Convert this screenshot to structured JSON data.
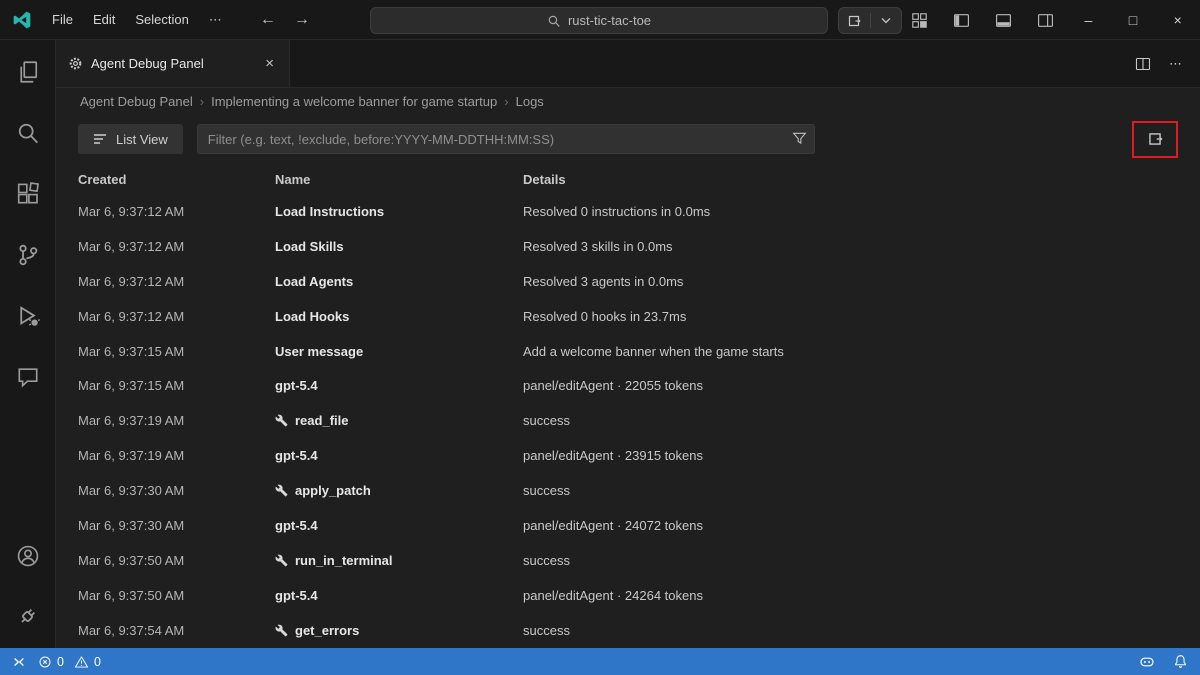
{
  "titlebar": {
    "menus": [
      "File",
      "Edit",
      "Selection"
    ],
    "search_value": "rust-tic-tac-toe"
  },
  "glyphs": {
    "more": "⋯",
    "back": "←",
    "forward": "→",
    "minimize": "–",
    "maximize": "□",
    "close": "×",
    "tab_close": "×",
    "breadcrumb_sep": "›"
  },
  "tab": {
    "title": "Agent Debug Panel"
  },
  "breadcrumb": [
    "Agent Debug Panel",
    "Implementing a welcome banner for game startup",
    "Logs"
  ],
  "toolbar": {
    "list_view_label": "List View",
    "filter_placeholder": "Filter (e.g. text, !exclude, before:YYYY-MM-DDTHH:MM:SS)"
  },
  "table": {
    "columns": [
      "Created",
      "Name",
      "Details"
    ],
    "rows": [
      {
        "created": "Mar 6, 9:37:12 AM",
        "name": "Load Instructions",
        "tool": false,
        "details": "Resolved 0 instructions in 0.0ms"
      },
      {
        "created": "Mar 6, 9:37:12 AM",
        "name": "Load Skills",
        "tool": false,
        "details": "Resolved 3 skills in 0.0ms"
      },
      {
        "created": "Mar 6, 9:37:12 AM",
        "name": "Load Agents",
        "tool": false,
        "details": "Resolved 3 agents in 0.0ms"
      },
      {
        "created": "Mar 6, 9:37:12 AM",
        "name": "Load Hooks",
        "tool": false,
        "details": "Resolved 0 hooks in 23.7ms"
      },
      {
        "created": "Mar 6, 9:37:15 AM",
        "name": "User message",
        "tool": false,
        "details": "Add a welcome banner when the game starts"
      },
      {
        "created": "Mar 6, 9:37:15 AM",
        "name": "gpt-5.4",
        "tool": false,
        "details": "panel/editAgent · 22055 tokens"
      },
      {
        "created": "Mar 6, 9:37:19 AM",
        "name": "read_file",
        "tool": true,
        "details": "success"
      },
      {
        "created": "Mar 6, 9:37:19 AM",
        "name": "gpt-5.4",
        "tool": false,
        "details": "panel/editAgent · 23915 tokens"
      },
      {
        "created": "Mar 6, 9:37:30 AM",
        "name": "apply_patch",
        "tool": true,
        "details": "success"
      },
      {
        "created": "Mar 6, 9:37:30 AM",
        "name": "gpt-5.4",
        "tool": false,
        "details": "panel/editAgent · 24072 tokens"
      },
      {
        "created": "Mar 6, 9:37:50 AM",
        "name": "run_in_terminal",
        "tool": true,
        "details": "success"
      },
      {
        "created": "Mar 6, 9:37:50 AM",
        "name": "gpt-5.4",
        "tool": false,
        "details": "panel/editAgent · 24264 tokens"
      },
      {
        "created": "Mar 6, 9:37:54 AM",
        "name": "get_errors",
        "tool": true,
        "details": "success"
      }
    ]
  },
  "status": {
    "errors": "0",
    "warnings": "0"
  },
  "colors": {
    "annotation-red": "#e01b24",
    "status-blue": "#2f76c8",
    "logo-teal": "#23b8ae"
  }
}
